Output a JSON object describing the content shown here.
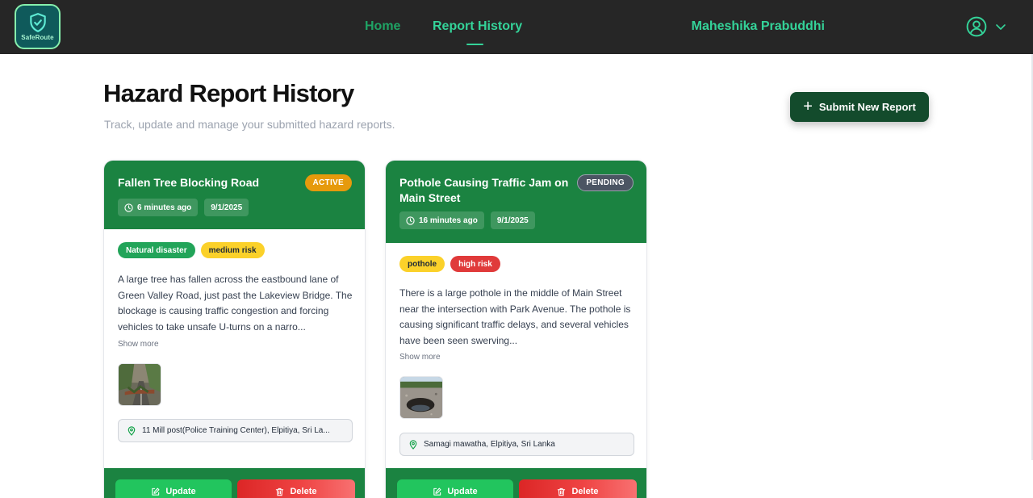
{
  "brand": {
    "name": "SafeRoute"
  },
  "nav": {
    "links": [
      {
        "label": "Home"
      },
      {
        "label": "Report History"
      }
    ],
    "user_name": "Maheshika Prabuddhi"
  },
  "header": {
    "title": "Hazard Report History",
    "subtitle": "Track, update and manage your submitted hazard reports.",
    "submit_label": "Submit New Report"
  },
  "reports": [
    {
      "title": "Fallen Tree Blocking Road",
      "status": "ACTIVE",
      "time_ago": "6 minutes ago",
      "date": "9/1/2025",
      "tags": [
        "Natural disaster",
        "medium risk"
      ],
      "description": "A large tree has fallen across the eastbound lane of Green Valley Road, just past the Lakeview Bridge. The blockage is causing traffic congestion and forcing vehicles to take unsafe U-turns on a narro...",
      "show_more": "Show more",
      "location": "11 Mill post(Police Training Center), Elpitiya, Sri La...",
      "update_label": "Update",
      "delete_label": "Delete"
    },
    {
      "title": "Pothole Causing Traffic Jam on Main Street",
      "status": "PENDING",
      "time_ago": "16 minutes ago",
      "date": "9/1/2025",
      "tags": [
        "pothole",
        "high risk"
      ],
      "description": "There is a large pothole in the middle of Main Street near the intersection with Park Avenue. The pothole is causing significant traffic delays, and several vehicles have been seen swerving...",
      "show_more": "Show more",
      "location": "Samagi mawatha, Elpitiya, Sri Lanka",
      "update_label": "Update",
      "delete_label": "Delete"
    }
  ],
  "colors": {
    "navbar": "#262626",
    "accent": "#34d399",
    "card_header": "#1b8341",
    "submit_button": "#134b2c",
    "status_active": "#e69a0c",
    "status_pending": "#4b5563",
    "risk_medium": "#fbd12a",
    "risk_high": "#e03a3a",
    "category": "#22a459"
  },
  "icons": [
    "shield-check-icon",
    "user-circle-icon",
    "chevron-down-icon",
    "plus-icon",
    "clock-icon",
    "map-pin-icon",
    "edit-icon",
    "trash-icon"
  ]
}
